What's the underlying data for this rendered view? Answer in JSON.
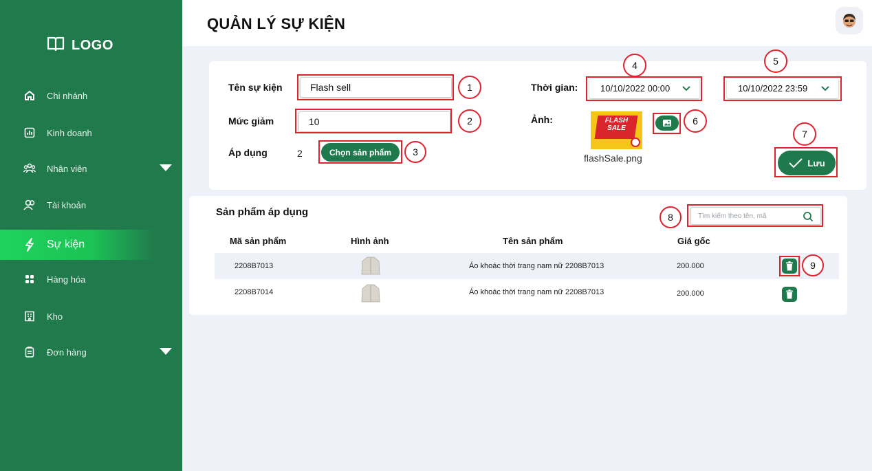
{
  "sidebar": {
    "logo": "LOGO",
    "items": [
      {
        "label": "Chi nhánh",
        "icon": "home-icon"
      },
      {
        "label": "Kinh doanh",
        "icon": "chart-icon"
      },
      {
        "label": "Nhân viên",
        "icon": "users-icon",
        "expandable": true
      },
      {
        "label": "Tài khoản",
        "icon": "account-icon"
      },
      {
        "label": "Sự kiện",
        "icon": "lightning-icon",
        "active": true
      },
      {
        "label": "Hàng hóa",
        "icon": "grid-icon"
      },
      {
        "label": "Kho",
        "icon": "building-icon"
      },
      {
        "label": "Đơn hàng",
        "icon": "clipboard-icon",
        "expandable": true
      }
    ]
  },
  "header": {
    "title": "QUẢN LÝ SỰ KIỆN"
  },
  "form": {
    "name_label": "Tên sự kiện",
    "name_value": "Flash sell",
    "discount_label": "Mức giảm",
    "discount_value": "10",
    "apply_label": "Áp dụng",
    "apply_count": "2",
    "choose_button": "Chọn sản phẩm",
    "time_label": "Thời gian:",
    "time_start": "10/10/2022 00:00",
    "time_end": "10/10/2022 23:59",
    "image_label": "Ảnh:",
    "image_filename": "flashSale.png",
    "image_text_line1": "FLASH",
    "image_text_line2": "SALE",
    "save_button": "Lưu"
  },
  "annotations": [
    "1",
    "2",
    "3",
    "4",
    "5",
    "6",
    "7",
    "8",
    "9"
  ],
  "products": {
    "title": "Sản phẩm áp dụng",
    "search_placeholder": "Tìm kiếm theo tên, mã",
    "columns": [
      "Mã sản phẩm",
      "Hình ảnh",
      "Tên sản phẩm",
      "Giá gốc"
    ],
    "rows": [
      {
        "code": "2208B7013",
        "name": "Áo khoác thời trang nam nữ 2208B7013",
        "price": "200.000"
      },
      {
        "code": "2208B7014",
        "name": "Áo khoác thời trang nam nữ 2208B7013",
        "price": "200.000"
      }
    ]
  },
  "colors": {
    "primary": "#1e7a4c",
    "sidebar": "#217a4c",
    "active": "#1fd35e",
    "annotation": "#e0222e"
  }
}
